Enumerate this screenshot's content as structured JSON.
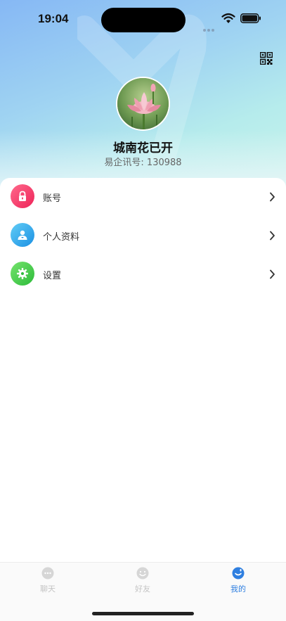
{
  "status_bar": {
    "time": "19:04"
  },
  "profile": {
    "name": "城南花已开",
    "id_label": "易企讯号: 130988"
  },
  "menu": {
    "items": [
      {
        "label": "账号",
        "icon": "lock-icon",
        "color_from": "#ff5a7e",
        "color_to": "#f0265a"
      },
      {
        "label": "个人资料",
        "icon": "user-icon",
        "color_from": "#5ec8f5",
        "color_to": "#1e96e6"
      },
      {
        "label": "设置",
        "icon": "gear-icon",
        "color_from": "#6fe06a",
        "color_to": "#2fbf3c"
      }
    ]
  },
  "tabbar": {
    "tabs": [
      {
        "label": "聊天",
        "icon": "chat-bubble-icon",
        "active": false
      },
      {
        "label": "好友",
        "icon": "smile-icon",
        "active": false
      },
      {
        "label": "我的",
        "icon": "me-icon",
        "active": true
      }
    ]
  },
  "colors": {
    "accent": "#2f7fe0",
    "inactive": "#c4c4c4"
  }
}
